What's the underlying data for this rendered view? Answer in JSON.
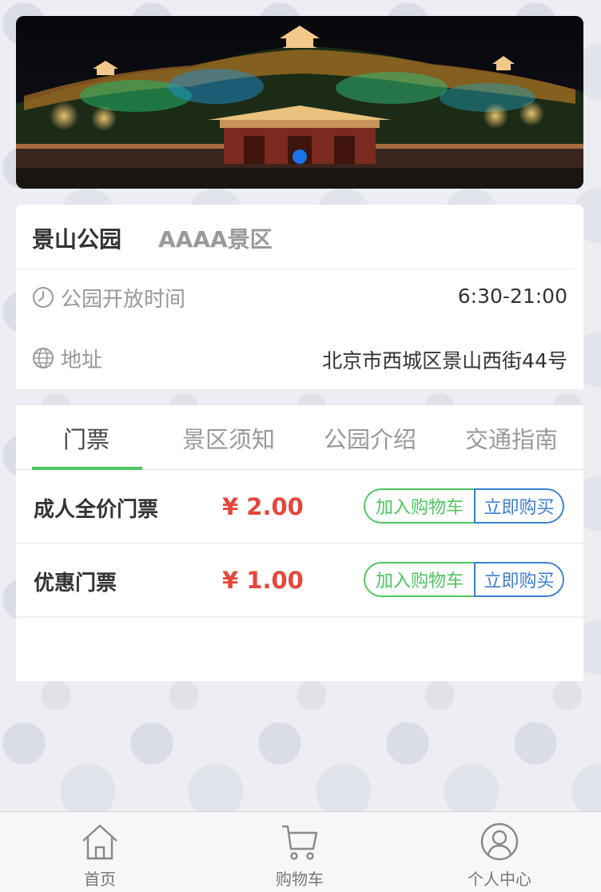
{
  "banner": {
    "carousel_dot_count": 1,
    "active_dot": 0,
    "dot_color": "#1a73e8"
  },
  "park": {
    "name": "景山公园",
    "level": "AAAA景区"
  },
  "info": {
    "hours_label": "公园开放时间",
    "hours_value": "6:30-21:00",
    "address_label": "地址",
    "address_value": "北京市西城区景山西街44号"
  },
  "tabs": [
    {
      "label": "门票"
    },
    {
      "label": "景区须知"
    },
    {
      "label": "公园介绍"
    },
    {
      "label": "交通指南"
    }
  ],
  "tickets": [
    {
      "name": "成人全价门票",
      "price": "¥ 2.00",
      "cart_label": "加入购物车",
      "buy_label": "立即购买"
    },
    {
      "name": "优惠门票",
      "price": "¥ 1.00",
      "cart_label": "加入购物车",
      "buy_label": "立即购买"
    }
  ],
  "nav": [
    {
      "label": "首页",
      "icon": "home-icon"
    },
    {
      "label": "购物车",
      "icon": "cart-icon"
    },
    {
      "label": "个人中心",
      "icon": "user-icon"
    }
  ],
  "colors": {
    "accent_green": "#4cc65f",
    "buy_blue": "#3a7fcf",
    "price_red": "#e4473b"
  }
}
